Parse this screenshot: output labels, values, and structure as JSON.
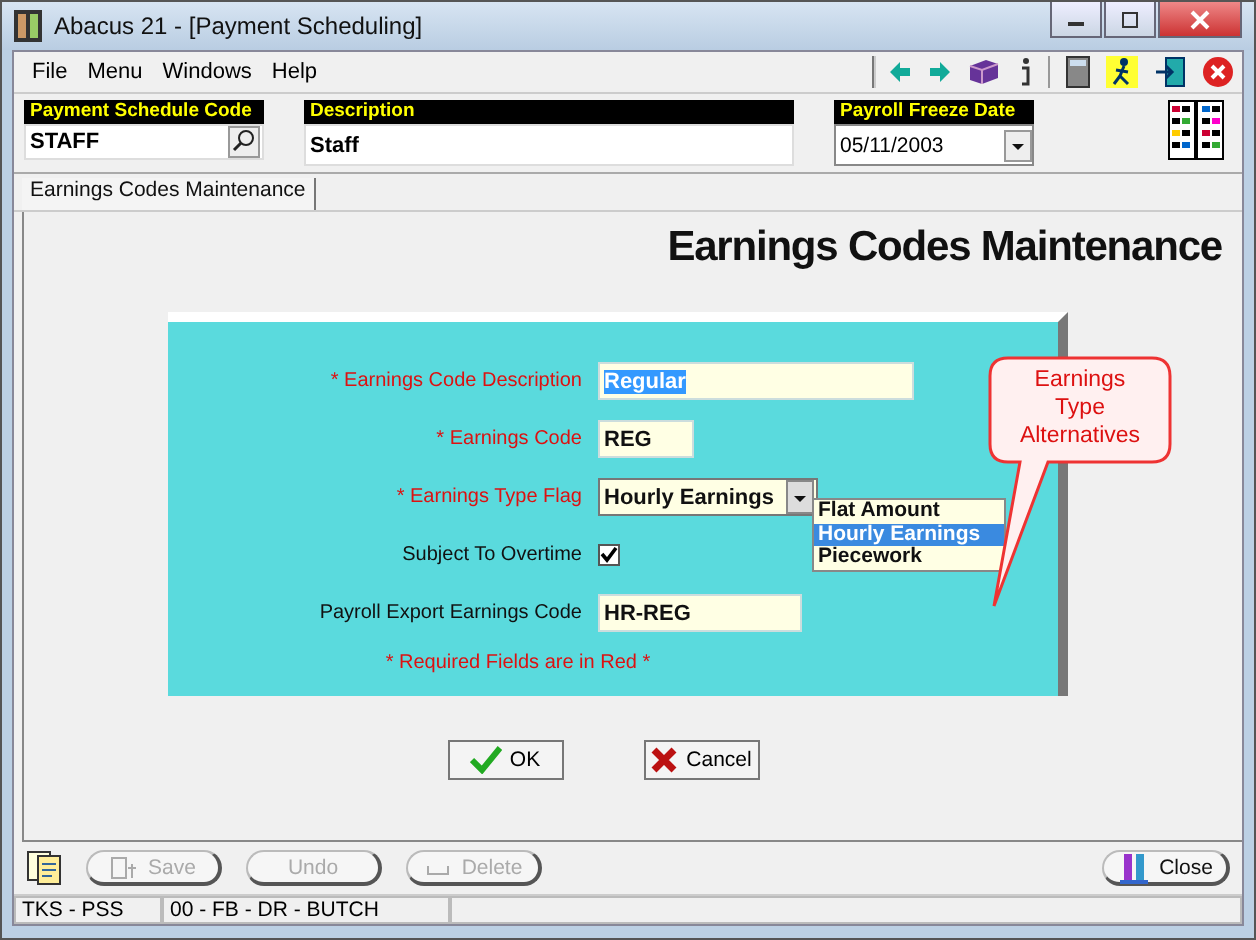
{
  "window": {
    "title": "Abacus 21 - [Payment Scheduling]"
  },
  "menu": [
    "File",
    "Menu",
    "Windows",
    "Help"
  ],
  "header_fields": [
    {
      "label": "Payment Schedule Code",
      "value": "STAFF",
      "kind": "lookup"
    },
    {
      "label": "Description",
      "value": "Staff",
      "kind": "text"
    },
    {
      "label": "Payroll Freeze Date",
      "value": "05/11/2003",
      "kind": "date"
    }
  ],
  "tabs": [
    {
      "label": "Earnings Codes Maintenance",
      "selected": true
    }
  ],
  "heading": "Earnings Codes Maintenance",
  "form": {
    "fields": [
      {
        "label": "* Earnings Code Description",
        "value": "Regular",
        "kind": "text",
        "required": true,
        "highlighted": true
      },
      {
        "label": "* Earnings Code",
        "value": "REG",
        "kind": "text",
        "required": true,
        "highlighted": false
      },
      {
        "label": "* Earnings Type Flag",
        "value": "Hourly Earnings",
        "kind": "select",
        "required": true
      },
      {
        "label": "Subject To Overtime",
        "kind": "checkbox",
        "checked": true,
        "required": false
      },
      {
        "label": "Payroll Export Earnings Code",
        "value": "HR-REG",
        "kind": "text",
        "required": false,
        "highlighted": false
      }
    ],
    "options": [
      {
        "label": "Flat Amount",
        "selected": false
      },
      {
        "label": "Hourly Earnings",
        "selected": true
      },
      {
        "label": "Piecework",
        "selected": false
      }
    ],
    "note": "* Required Fields are in Red *"
  },
  "callout": "Earnings Type Alternatives",
  "dialog_buttons": [
    {
      "label": "OK",
      "kind": "ok"
    },
    {
      "label": "Cancel",
      "kind": "cancel"
    }
  ],
  "toolbar_buttons": [
    {
      "label": "Save",
      "kind": "save",
      "disabled": true
    },
    {
      "label": "Undo",
      "kind": "undo",
      "disabled": true
    },
    {
      "label": "Delete",
      "kind": "delete",
      "disabled": true
    }
  ],
  "close_button": {
    "label": "Close",
    "disabled": false
  },
  "status_bar": [
    "TKS - PSS",
    "00 - FB - DR - BUTCH"
  ]
}
